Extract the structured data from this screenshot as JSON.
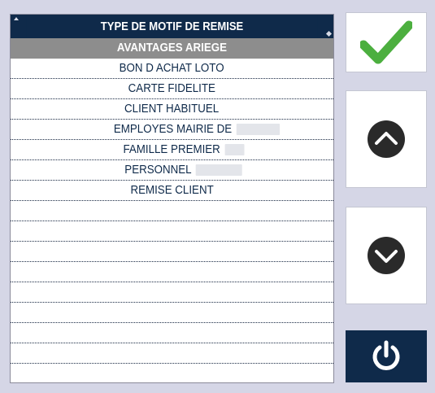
{
  "list": {
    "header": "TYPE DE MOTIF DE REMISE",
    "items": [
      {
        "label": "AVANTAGES ARIEGE",
        "selected": true
      },
      {
        "label": "BON D ACHAT LOTO"
      },
      {
        "label": "CARTE FIDELITE"
      },
      {
        "label": "CLIENT HABITUEL"
      },
      {
        "label": "EMPLOYES MAIRIE DE"
      },
      {
        "label": "FAMILLE PREMIER"
      },
      {
        "label": "PERSONNEL"
      },
      {
        "label": "REMISE CLIENT"
      }
    ]
  },
  "buttons": {
    "validate_icon": "checkmark-icon",
    "up_icon": "chevron-up-circle-icon",
    "down_icon": "chevron-down-circle-icon",
    "power_icon": "power-icon"
  },
  "colors": {
    "background": "#d5d6e6",
    "navy": "#0f2a4a",
    "selected_row": "#8d8d8d",
    "check_green": "#4caf3f",
    "icon_dark": "#2a2a2a"
  }
}
